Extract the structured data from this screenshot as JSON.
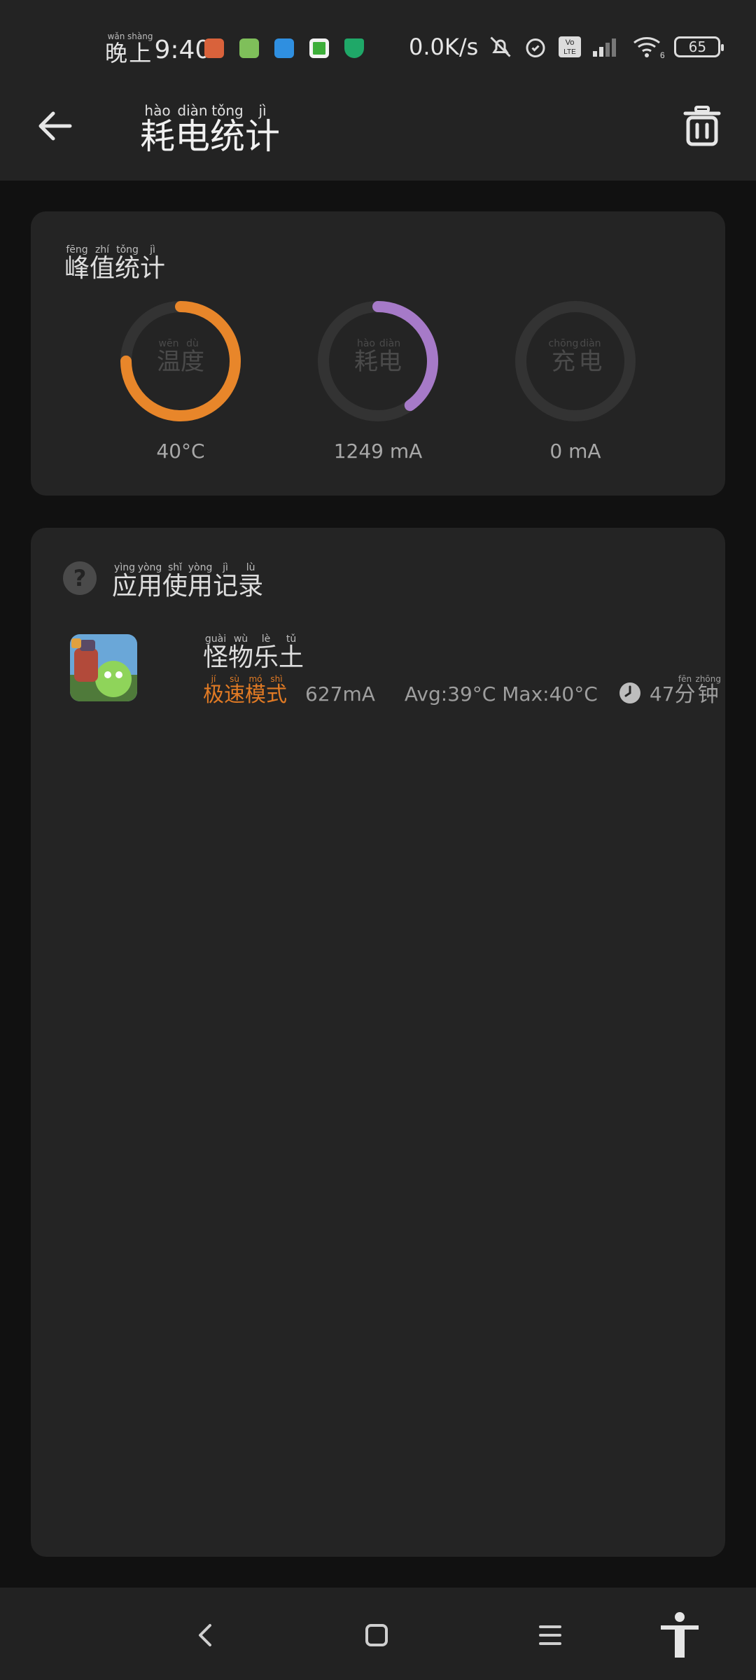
{
  "status_bar": {
    "period_pinyin": [
      "wǎn",
      "shàng"
    ],
    "period_chars": [
      "晚",
      "上"
    ],
    "time": "9:40",
    "net_speed": "0.0K/s",
    "battery": "65",
    "wifi_sub": "6",
    "volte_label_top": "Vo",
    "volte_label_bottom": "LTE"
  },
  "app_bar": {
    "title_pinyin": [
      "hào",
      "diàn",
      "tǒng",
      "jì"
    ],
    "title_chars": [
      "耗",
      "电",
      "统",
      "计"
    ]
  },
  "peak_card": {
    "title_pinyin": [
      "fēng",
      "zhí",
      "tǒng",
      "jì"
    ],
    "title_chars": [
      "峰",
      "值",
      "统",
      "计"
    ],
    "gauges": [
      {
        "label_pinyin": [
          "wēn",
          "dù"
        ],
        "label_chars": [
          "温",
          "度"
        ],
        "value": "40°C",
        "color": "#e8862a",
        "fraction": 0.75
      },
      {
        "label_pinyin": [
          "hào",
          "diàn"
        ],
        "label_chars": [
          "耗",
          "电"
        ],
        "value": "1249 mA",
        "color": "#a67ac8",
        "fraction": 0.4
      },
      {
        "label_pinyin": [
          "chōng",
          "diàn"
        ],
        "label_chars": [
          "充",
          "电"
        ],
        "value": "0 mA",
        "color": "#333333",
        "fraction": 0.0
      }
    ]
  },
  "usage_card": {
    "title_pinyin": [
      "yìng",
      "yòng",
      "shǐ",
      "yòng",
      "jì",
      "lù"
    ],
    "title_chars": [
      "应",
      "用",
      "使",
      "用",
      "记",
      "录"
    ],
    "help_icon_text": "?",
    "records": [
      {
        "name_pinyin": [
          "guài",
          "wù",
          "lè",
          "tǔ"
        ],
        "name_chars": [
          "怪",
          "物",
          "乐",
          "土"
        ],
        "mode_pinyin": [
          "jí",
          "sù",
          "mó",
          "shì"
        ],
        "mode_chars": [
          "极",
          "速",
          "模",
          "式"
        ],
        "current": "627mA",
        "temp": "Avg:39°C Max:40°C",
        "duration_number": "47",
        "duration_pinyin": [
          "fēn",
          "zhōng"
        ],
        "duration_chars": [
          "分",
          "钟"
        ]
      }
    ]
  },
  "colors": {
    "background": "#111111",
    "card": "#242424",
    "accent_orange": "#e8862a",
    "accent_purple": "#a67ac8"
  },
  "icons": [
    "back-arrow-icon",
    "trash-icon",
    "help-icon",
    "clock-icon",
    "nav-back-icon",
    "nav-home-icon",
    "nav-menu-icon",
    "accessibility-icon"
  ]
}
